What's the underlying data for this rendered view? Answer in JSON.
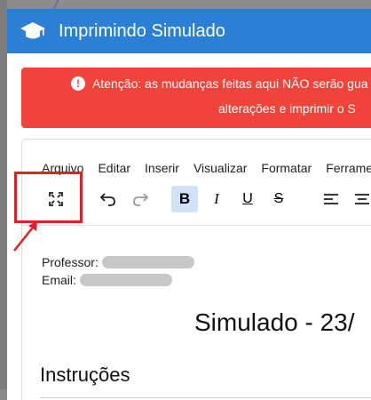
{
  "modal": {
    "title": "Imprimindo Simulado",
    "title_icon": "graduation-cap-icon",
    "header_color": "#2b7fd4"
  },
  "alert": {
    "line1": "Atenção: as mudanças feitas aqui NÃO serão gua",
    "line2": "alterações e imprimir o S",
    "icon": "exclamation-circle-icon",
    "color": "#f0433a"
  },
  "editor": {
    "menu": [
      "Arquivo",
      "Editar",
      "Inserir",
      "Visualizar",
      "Formatar",
      "Ferrame"
    ],
    "toolbar": {
      "fullscreen_icon": "fullscreen-icon",
      "undo_icon": "undo-icon",
      "redo_icon": "redo-icon",
      "bold_label": "B",
      "italic_label": "I",
      "underline_label": "U",
      "strike_label": "S",
      "align_left_icon": "align-left-icon",
      "align_center_icon": "align-center-icon"
    },
    "content": {
      "professor_label": "Professor:",
      "email_label": "Email:",
      "title": "Simulado - 23/",
      "instructions_heading": "Instruções"
    }
  },
  "annotation": {
    "highlight_color": "#e0202a"
  }
}
